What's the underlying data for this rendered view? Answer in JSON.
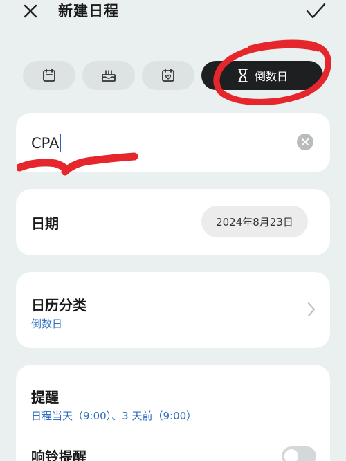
{
  "header": {
    "title": "新建日程",
    "close_icon": "close-icon",
    "confirm_icon": "checkmark-icon"
  },
  "type_tabs": [
    {
      "icon": "calendar-icon",
      "label": ""
    },
    {
      "icon": "birthday-cake-icon",
      "label": ""
    },
    {
      "icon": "anniversary-heart-calendar-icon",
      "label": ""
    },
    {
      "icon": "hourglass-icon",
      "label": "倒数日",
      "selected": true
    }
  ],
  "name_field": {
    "value": "CPA"
  },
  "date_row": {
    "label": "日期",
    "value": "2024年8月23日"
  },
  "calendar_category": {
    "label": "日历分类",
    "value": "倒数日"
  },
  "reminder": {
    "label": "提醒",
    "value": "日程当天（9:00）、3 天前（9:00）",
    "ring_label": "响铃提醒",
    "ring_enabled": false
  },
  "colors": {
    "background": "#e9f0ef",
    "accent_blue": "#2f6fc0",
    "selected_tab": "#1e1f21",
    "annotation_red": "#e5262c"
  }
}
